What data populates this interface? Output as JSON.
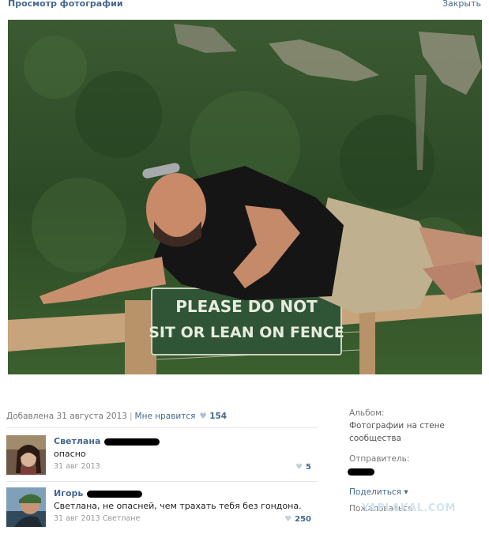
{
  "header": {
    "title": "Просмотр фотографии",
    "close_label": "Закрыть"
  },
  "photo": {
    "sign_line1": "PLEASE DO NOT",
    "sign_line2": "SIT OR LEAN ON FENCE"
  },
  "meta": {
    "added": "Добавлена 31 августа 2013",
    "separator": "|",
    "like_label": "Мне нравится",
    "heart_icon": "♥",
    "like_count": "154"
  },
  "comments": [
    {
      "author": "Светлана",
      "text": "опасно",
      "date": "31 авг 2013",
      "likes": "5"
    },
    {
      "author": "Игорь",
      "text": "Светлана, не опасней, чем трахать тебя без гондона.",
      "date": "31 авг 2013 Светлане",
      "likes": "250"
    }
  ],
  "sidebar": {
    "album_label": "Альбом:",
    "album_value": "Фотографии на стене сообщества",
    "sender_label": "Отправитель:",
    "share_label": "Поделиться",
    "share_arrow": "▾",
    "complain_label": "Пожаловаться"
  },
  "watermark": "YAPLAKAL.COM",
  "colors": {
    "link": "#45688e",
    "divider": "#e4e8ed"
  }
}
